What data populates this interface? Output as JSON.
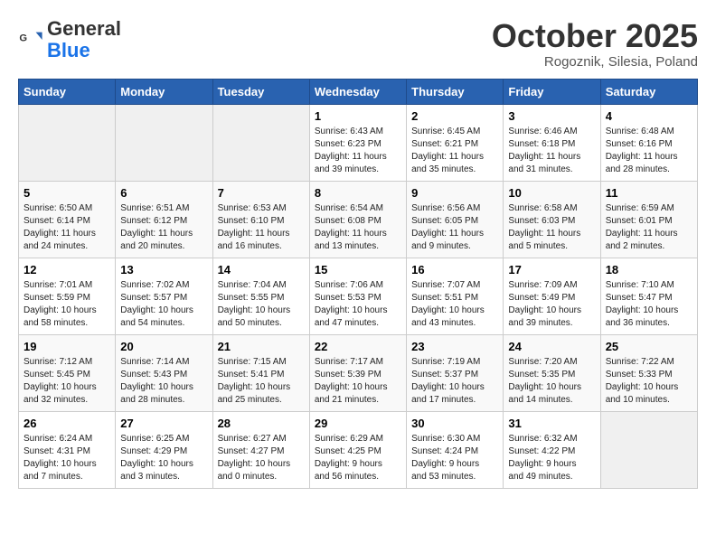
{
  "header": {
    "logo_general": "General",
    "logo_blue": "Blue",
    "month_title": "October 2025",
    "subtitle": "Rogoznik, Silesia, Poland"
  },
  "days_of_week": [
    "Sunday",
    "Monday",
    "Tuesday",
    "Wednesday",
    "Thursday",
    "Friday",
    "Saturday"
  ],
  "weeks": [
    [
      {
        "day": "",
        "info": ""
      },
      {
        "day": "",
        "info": ""
      },
      {
        "day": "",
        "info": ""
      },
      {
        "day": "1",
        "info": "Sunrise: 6:43 AM\nSunset: 6:23 PM\nDaylight: 11 hours\nand 39 minutes."
      },
      {
        "day": "2",
        "info": "Sunrise: 6:45 AM\nSunset: 6:21 PM\nDaylight: 11 hours\nand 35 minutes."
      },
      {
        "day": "3",
        "info": "Sunrise: 6:46 AM\nSunset: 6:18 PM\nDaylight: 11 hours\nand 31 minutes."
      },
      {
        "day": "4",
        "info": "Sunrise: 6:48 AM\nSunset: 6:16 PM\nDaylight: 11 hours\nand 28 minutes."
      }
    ],
    [
      {
        "day": "5",
        "info": "Sunrise: 6:50 AM\nSunset: 6:14 PM\nDaylight: 11 hours\nand 24 minutes."
      },
      {
        "day": "6",
        "info": "Sunrise: 6:51 AM\nSunset: 6:12 PM\nDaylight: 11 hours\nand 20 minutes."
      },
      {
        "day": "7",
        "info": "Sunrise: 6:53 AM\nSunset: 6:10 PM\nDaylight: 11 hours\nand 16 minutes."
      },
      {
        "day": "8",
        "info": "Sunrise: 6:54 AM\nSunset: 6:08 PM\nDaylight: 11 hours\nand 13 minutes."
      },
      {
        "day": "9",
        "info": "Sunrise: 6:56 AM\nSunset: 6:05 PM\nDaylight: 11 hours\nand 9 minutes."
      },
      {
        "day": "10",
        "info": "Sunrise: 6:58 AM\nSunset: 6:03 PM\nDaylight: 11 hours\nand 5 minutes."
      },
      {
        "day": "11",
        "info": "Sunrise: 6:59 AM\nSunset: 6:01 PM\nDaylight: 11 hours\nand 2 minutes."
      }
    ],
    [
      {
        "day": "12",
        "info": "Sunrise: 7:01 AM\nSunset: 5:59 PM\nDaylight: 10 hours\nand 58 minutes."
      },
      {
        "day": "13",
        "info": "Sunrise: 7:02 AM\nSunset: 5:57 PM\nDaylight: 10 hours\nand 54 minutes."
      },
      {
        "day": "14",
        "info": "Sunrise: 7:04 AM\nSunset: 5:55 PM\nDaylight: 10 hours\nand 50 minutes."
      },
      {
        "day": "15",
        "info": "Sunrise: 7:06 AM\nSunset: 5:53 PM\nDaylight: 10 hours\nand 47 minutes."
      },
      {
        "day": "16",
        "info": "Sunrise: 7:07 AM\nSunset: 5:51 PM\nDaylight: 10 hours\nand 43 minutes."
      },
      {
        "day": "17",
        "info": "Sunrise: 7:09 AM\nSunset: 5:49 PM\nDaylight: 10 hours\nand 39 minutes."
      },
      {
        "day": "18",
        "info": "Sunrise: 7:10 AM\nSunset: 5:47 PM\nDaylight: 10 hours\nand 36 minutes."
      }
    ],
    [
      {
        "day": "19",
        "info": "Sunrise: 7:12 AM\nSunset: 5:45 PM\nDaylight: 10 hours\nand 32 minutes."
      },
      {
        "day": "20",
        "info": "Sunrise: 7:14 AM\nSunset: 5:43 PM\nDaylight: 10 hours\nand 28 minutes."
      },
      {
        "day": "21",
        "info": "Sunrise: 7:15 AM\nSunset: 5:41 PM\nDaylight: 10 hours\nand 25 minutes."
      },
      {
        "day": "22",
        "info": "Sunrise: 7:17 AM\nSunset: 5:39 PM\nDaylight: 10 hours\nand 21 minutes."
      },
      {
        "day": "23",
        "info": "Sunrise: 7:19 AM\nSunset: 5:37 PM\nDaylight: 10 hours\nand 17 minutes."
      },
      {
        "day": "24",
        "info": "Sunrise: 7:20 AM\nSunset: 5:35 PM\nDaylight: 10 hours\nand 14 minutes."
      },
      {
        "day": "25",
        "info": "Sunrise: 7:22 AM\nSunset: 5:33 PM\nDaylight: 10 hours\nand 10 minutes."
      }
    ],
    [
      {
        "day": "26",
        "info": "Sunrise: 6:24 AM\nSunset: 4:31 PM\nDaylight: 10 hours\nand 7 minutes."
      },
      {
        "day": "27",
        "info": "Sunrise: 6:25 AM\nSunset: 4:29 PM\nDaylight: 10 hours\nand 3 minutes."
      },
      {
        "day": "28",
        "info": "Sunrise: 6:27 AM\nSunset: 4:27 PM\nDaylight: 10 hours\nand 0 minutes."
      },
      {
        "day": "29",
        "info": "Sunrise: 6:29 AM\nSunset: 4:25 PM\nDaylight: 9 hours\nand 56 minutes."
      },
      {
        "day": "30",
        "info": "Sunrise: 6:30 AM\nSunset: 4:24 PM\nDaylight: 9 hours\nand 53 minutes."
      },
      {
        "day": "31",
        "info": "Sunrise: 6:32 AM\nSunset: 4:22 PM\nDaylight: 9 hours\nand 49 minutes."
      },
      {
        "day": "",
        "info": ""
      }
    ]
  ]
}
